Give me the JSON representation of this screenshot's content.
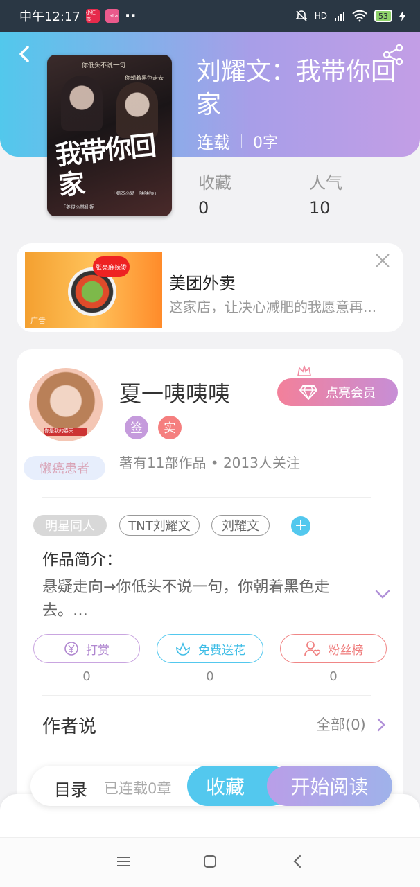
{
  "status_bar": {
    "time": "中午12:17",
    "app1": "小红书",
    "app2": "LaLa",
    "dots": "··",
    "battery": "53",
    "network": "HD"
  },
  "header": {
    "title": "刘耀文：我带你回家",
    "status": "连载",
    "word_count": "0字"
  },
  "cover": {
    "title": "我带你回家",
    "tagline": "你低头不说一句",
    "tagline2": "你朝着黑色走去",
    "credit": "「脑本◎夏一咦咦咦」",
    "credit2": "「姜俊◎林仙妮」"
  },
  "stats": {
    "fav_label": "收藏",
    "fav_value": "0",
    "pop_label": "人气",
    "pop_value": "10"
  },
  "ad": {
    "title": "美团外卖",
    "desc": "这家店，让决心减肥的我愿意再...",
    "img_tag": "张亮麻辣烫",
    "img_mark": "广告"
  },
  "author": {
    "name": "夏一咦咦咦",
    "vip_label": "点亮会员",
    "badge_sign": "签",
    "badge_real": "实",
    "works": "著有11部作品 • 2013人关注",
    "title_badge": "懒癌患者",
    "avatar_caption": "你是我的春天"
  },
  "tags": [
    "明星同人",
    "TNT刘耀文",
    "刘耀文"
  ],
  "intro": {
    "title": "作品简介：",
    "text": "悬疑走向→你低头不说一句，你朝着黑色走去。…"
  },
  "actions": [
    {
      "label": "打赏",
      "count": "0"
    },
    {
      "label": "免费送花",
      "count": "0"
    },
    {
      "label": "粉丝榜",
      "count": "0"
    }
  ],
  "author_says": {
    "title": "作者说",
    "all": "全部(0)"
  },
  "bottom": {
    "toc": "目录",
    "chapters": "已连载0章",
    "fav": "收藏",
    "read": "开始阅读"
  },
  "colors": {
    "accent_blue": "#53c8ee",
    "accent_purple": "#b99ee8",
    "vip_pink": "#f3809a"
  }
}
